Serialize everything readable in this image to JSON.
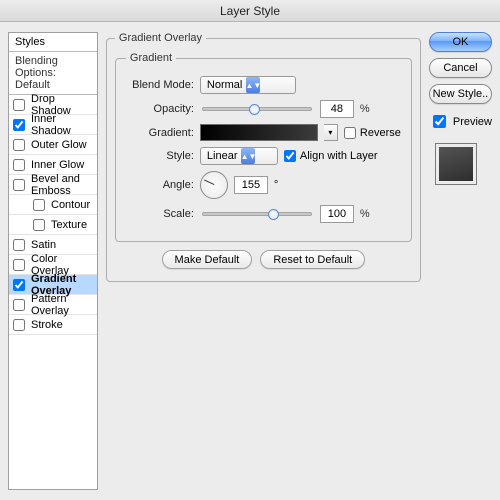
{
  "title": "Layer Style",
  "sidebar": {
    "header": "Styles",
    "blending": "Blending Options: Default",
    "items": [
      {
        "label": "Drop Shadow",
        "checked": false,
        "selected": false,
        "sub": false
      },
      {
        "label": "Inner Shadow",
        "checked": true,
        "selected": false,
        "sub": false
      },
      {
        "label": "Outer Glow",
        "checked": false,
        "selected": false,
        "sub": false
      },
      {
        "label": "Inner Glow",
        "checked": false,
        "selected": false,
        "sub": false
      },
      {
        "label": "Bevel and Emboss",
        "checked": false,
        "selected": false,
        "sub": false
      },
      {
        "label": "Contour",
        "checked": false,
        "selected": false,
        "sub": true
      },
      {
        "label": "Texture",
        "checked": false,
        "selected": false,
        "sub": true
      },
      {
        "label": "Satin",
        "checked": false,
        "selected": false,
        "sub": false
      },
      {
        "label": "Color Overlay",
        "checked": false,
        "selected": false,
        "sub": false
      },
      {
        "label": "Gradient Overlay",
        "checked": true,
        "selected": true,
        "sub": false
      },
      {
        "label": "Pattern Overlay",
        "checked": false,
        "selected": false,
        "sub": false
      },
      {
        "label": "Stroke",
        "checked": false,
        "selected": false,
        "sub": false
      }
    ]
  },
  "panel": {
    "legend_outer": "Gradient Overlay",
    "legend_inner": "Gradient",
    "blend_mode_label": "Blend Mode:",
    "blend_mode_value": "Normal",
    "opacity_label": "Opacity:",
    "opacity_value": "48",
    "pct": "%",
    "gradient_label": "Gradient:",
    "reverse_label": "Reverse",
    "reverse_checked": false,
    "style_label": "Style:",
    "style_value": "Linear",
    "align_label": "Align with Layer",
    "align_checked": true,
    "angle_label": "Angle:",
    "angle_value": "155",
    "degree": "°",
    "scale_label": "Scale:",
    "scale_value": "100",
    "make_default": "Make Default",
    "reset_default": "Reset to Default"
  },
  "buttons": {
    "ok": "OK",
    "cancel": "Cancel",
    "new_style": "New Style..",
    "preview_label": "Preview",
    "preview_checked": true
  }
}
